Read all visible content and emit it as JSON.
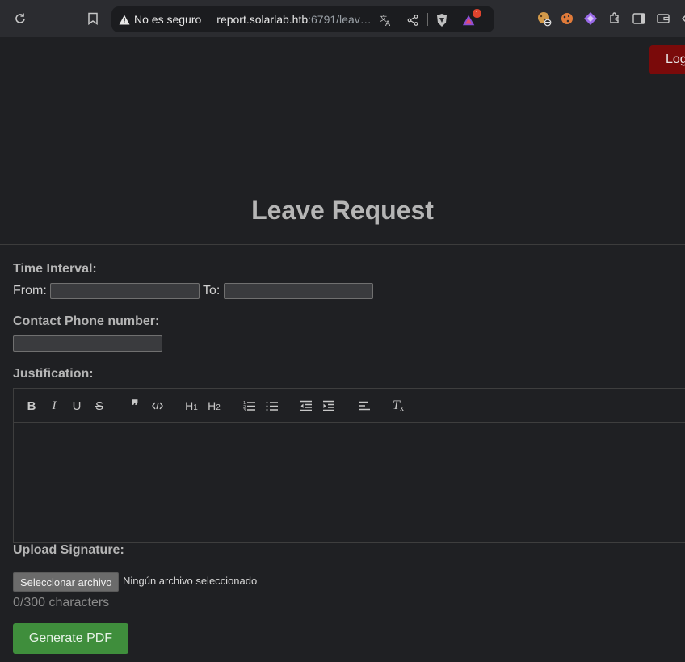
{
  "browser": {
    "security_text": "No es seguro",
    "url_host": "report.solarlab.htb",
    "url_rest": ":6791/leav…",
    "extension_badge": "1"
  },
  "header": {
    "logout_label": "Log"
  },
  "form": {
    "title": "Leave Request",
    "time_interval_label": "Time Interval:",
    "from_label": "From:",
    "to_label": "To:",
    "from_value": "",
    "to_value": "",
    "phone_label": "Contact Phone number:",
    "phone_value": "",
    "justification_label": "Justification:",
    "editor_toolbar": [
      "bold",
      "italic",
      "underline",
      "strike",
      "blockquote",
      "code",
      "header-1",
      "header-2",
      "ordered-list",
      "bullet-list",
      "outdent",
      "indent",
      "align",
      "clean"
    ],
    "editor_content": "",
    "signature_label": "Upload Signature:",
    "file_button_label": "Seleccionar archivo",
    "no_file_text": "Ningún archivo seleccionado",
    "char_counter": "0/300 characters",
    "generate_button_label": "Generate PDF"
  },
  "colors": {
    "logout_bg": "#7a0a0a",
    "generate_bg": "#3f8e3c"
  }
}
